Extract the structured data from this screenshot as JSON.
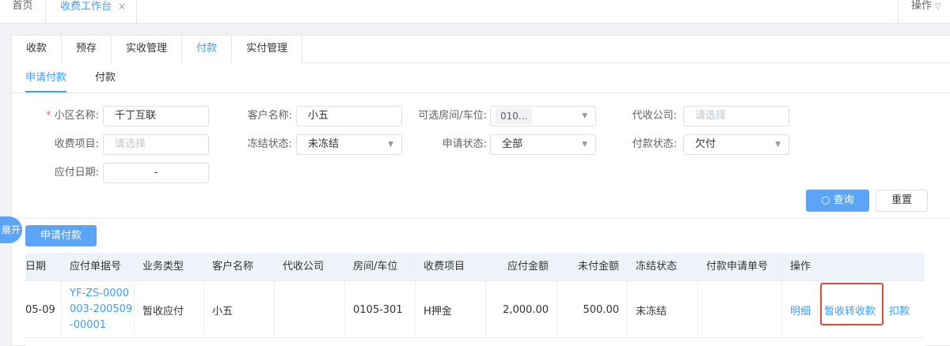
{
  "top_tabs": {
    "home": "首页",
    "active": "收费工作台",
    "close": "×",
    "ops": "操作"
  },
  "main_tabs": [
    "收款",
    "预存",
    "实收管理",
    "付款",
    "实付管理"
  ],
  "main_tab_active": 3,
  "sub_tabs": [
    "申请付款",
    "付款"
  ],
  "sub_tab_active": 0,
  "form": {
    "community_label": "小区名称:",
    "community_value": "千丁互联",
    "customer_label": "客户名称:",
    "customer_value": "小五",
    "room_label": "可选房间/车位:",
    "room_tag": "010...",
    "agent_label": "代收公司:",
    "agent_placeholder": "请选择",
    "item_label": "收费项目:",
    "item_placeholder": "请选择",
    "freeze_label": "冻结状态:",
    "freeze_value": "未冻结",
    "apply_label": "申请状态:",
    "apply_value": "全部",
    "pay_label": "付款状态:",
    "pay_value": "欠付",
    "date_label": "应付日期:",
    "date_sep": "-"
  },
  "buttons": {
    "query": "查询",
    "reset": "重置",
    "apply_pay": "申请付款",
    "expand": "展开"
  },
  "table": {
    "headers": [
      "日期",
      "应付单据号",
      "业务类型",
      "客户名称",
      "代收公司",
      "房间/车位",
      "收费项目",
      "应付金额",
      "未付金额",
      "冻结状态",
      "付款申请单号",
      "操作"
    ],
    "row": {
      "date": "05-09",
      "doc_no_1": "YF-ZS-0000",
      "doc_no_2": "003-200509",
      "doc_no_3": "-00001",
      "biz_type": "暂收应付",
      "customer": "小五",
      "agent": "",
      "room": "0105-301",
      "item": "H押金",
      "payable": "2,000.00",
      "unpaid": "500.00",
      "freeze": "未冻结",
      "apply_no": "",
      "op_detail": "明细",
      "op_transfer": "暂收转收款",
      "op_deduct": "扣款"
    }
  },
  "colors": {
    "accent": "#409eff",
    "button": "#5ca4f5",
    "highlight": "#e24b3b"
  }
}
